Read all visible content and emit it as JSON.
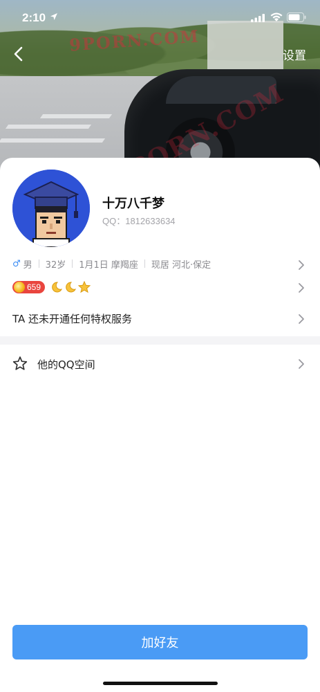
{
  "status_bar": {
    "time": "2:10"
  },
  "nav": {
    "settings_label": "设置"
  },
  "profile": {
    "nickname": "十万八千梦",
    "qq_number": "QQ：1812633634",
    "info": {
      "gender": "男",
      "age": "32岁",
      "birthday_sign": "1月1日 摩羯座",
      "location": "现居 河北·保定"
    },
    "level": {
      "coin_value": "659",
      "icons": [
        "moon-icon",
        "moon-icon",
        "star-icon"
      ]
    },
    "privilege_text": "TA 还未开通任何特权服务"
  },
  "qzone": {
    "label": "他的QQ空间"
  },
  "actions": {
    "add_friend_label": "加好友"
  },
  "colors": {
    "accent": "#4a9bf5",
    "coin_badge": "#e9453e",
    "gender": "#3b8df5"
  }
}
